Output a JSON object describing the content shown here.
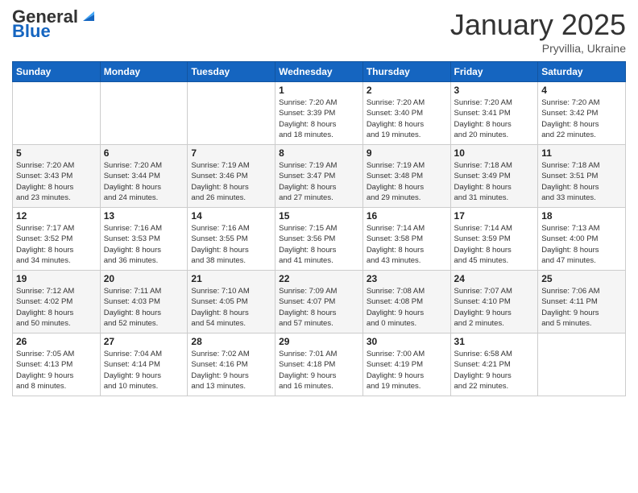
{
  "header": {
    "logo_general": "General",
    "logo_blue": "Blue",
    "month": "January 2025",
    "location": "Pryvillia, Ukraine"
  },
  "weekdays": [
    "Sunday",
    "Monday",
    "Tuesday",
    "Wednesday",
    "Thursday",
    "Friday",
    "Saturday"
  ],
  "weeks": [
    [
      {
        "day": "",
        "info": ""
      },
      {
        "day": "",
        "info": ""
      },
      {
        "day": "",
        "info": ""
      },
      {
        "day": "1",
        "info": "Sunrise: 7:20 AM\nSunset: 3:39 PM\nDaylight: 8 hours\nand 18 minutes."
      },
      {
        "day": "2",
        "info": "Sunrise: 7:20 AM\nSunset: 3:40 PM\nDaylight: 8 hours\nand 19 minutes."
      },
      {
        "day": "3",
        "info": "Sunrise: 7:20 AM\nSunset: 3:41 PM\nDaylight: 8 hours\nand 20 minutes."
      },
      {
        "day": "4",
        "info": "Sunrise: 7:20 AM\nSunset: 3:42 PM\nDaylight: 8 hours\nand 22 minutes."
      }
    ],
    [
      {
        "day": "5",
        "info": "Sunrise: 7:20 AM\nSunset: 3:43 PM\nDaylight: 8 hours\nand 23 minutes."
      },
      {
        "day": "6",
        "info": "Sunrise: 7:20 AM\nSunset: 3:44 PM\nDaylight: 8 hours\nand 24 minutes."
      },
      {
        "day": "7",
        "info": "Sunrise: 7:19 AM\nSunset: 3:46 PM\nDaylight: 8 hours\nand 26 minutes."
      },
      {
        "day": "8",
        "info": "Sunrise: 7:19 AM\nSunset: 3:47 PM\nDaylight: 8 hours\nand 27 minutes."
      },
      {
        "day": "9",
        "info": "Sunrise: 7:19 AM\nSunset: 3:48 PM\nDaylight: 8 hours\nand 29 minutes."
      },
      {
        "day": "10",
        "info": "Sunrise: 7:18 AM\nSunset: 3:49 PM\nDaylight: 8 hours\nand 31 minutes."
      },
      {
        "day": "11",
        "info": "Sunrise: 7:18 AM\nSunset: 3:51 PM\nDaylight: 8 hours\nand 33 minutes."
      }
    ],
    [
      {
        "day": "12",
        "info": "Sunrise: 7:17 AM\nSunset: 3:52 PM\nDaylight: 8 hours\nand 34 minutes."
      },
      {
        "day": "13",
        "info": "Sunrise: 7:16 AM\nSunset: 3:53 PM\nDaylight: 8 hours\nand 36 minutes."
      },
      {
        "day": "14",
        "info": "Sunrise: 7:16 AM\nSunset: 3:55 PM\nDaylight: 8 hours\nand 38 minutes."
      },
      {
        "day": "15",
        "info": "Sunrise: 7:15 AM\nSunset: 3:56 PM\nDaylight: 8 hours\nand 41 minutes."
      },
      {
        "day": "16",
        "info": "Sunrise: 7:14 AM\nSunset: 3:58 PM\nDaylight: 8 hours\nand 43 minutes."
      },
      {
        "day": "17",
        "info": "Sunrise: 7:14 AM\nSunset: 3:59 PM\nDaylight: 8 hours\nand 45 minutes."
      },
      {
        "day": "18",
        "info": "Sunrise: 7:13 AM\nSunset: 4:00 PM\nDaylight: 8 hours\nand 47 minutes."
      }
    ],
    [
      {
        "day": "19",
        "info": "Sunrise: 7:12 AM\nSunset: 4:02 PM\nDaylight: 8 hours\nand 50 minutes."
      },
      {
        "day": "20",
        "info": "Sunrise: 7:11 AM\nSunset: 4:03 PM\nDaylight: 8 hours\nand 52 minutes."
      },
      {
        "day": "21",
        "info": "Sunrise: 7:10 AM\nSunset: 4:05 PM\nDaylight: 8 hours\nand 54 minutes."
      },
      {
        "day": "22",
        "info": "Sunrise: 7:09 AM\nSunset: 4:07 PM\nDaylight: 8 hours\nand 57 minutes."
      },
      {
        "day": "23",
        "info": "Sunrise: 7:08 AM\nSunset: 4:08 PM\nDaylight: 9 hours\nand 0 minutes."
      },
      {
        "day": "24",
        "info": "Sunrise: 7:07 AM\nSunset: 4:10 PM\nDaylight: 9 hours\nand 2 minutes."
      },
      {
        "day": "25",
        "info": "Sunrise: 7:06 AM\nSunset: 4:11 PM\nDaylight: 9 hours\nand 5 minutes."
      }
    ],
    [
      {
        "day": "26",
        "info": "Sunrise: 7:05 AM\nSunset: 4:13 PM\nDaylight: 9 hours\nand 8 minutes."
      },
      {
        "day": "27",
        "info": "Sunrise: 7:04 AM\nSunset: 4:14 PM\nDaylight: 9 hours\nand 10 minutes."
      },
      {
        "day": "28",
        "info": "Sunrise: 7:02 AM\nSunset: 4:16 PM\nDaylight: 9 hours\nand 13 minutes."
      },
      {
        "day": "29",
        "info": "Sunrise: 7:01 AM\nSunset: 4:18 PM\nDaylight: 9 hours\nand 16 minutes."
      },
      {
        "day": "30",
        "info": "Sunrise: 7:00 AM\nSunset: 4:19 PM\nDaylight: 9 hours\nand 19 minutes."
      },
      {
        "day": "31",
        "info": "Sunrise: 6:58 AM\nSunset: 4:21 PM\nDaylight: 9 hours\nand 22 minutes."
      },
      {
        "day": "",
        "info": ""
      }
    ]
  ]
}
